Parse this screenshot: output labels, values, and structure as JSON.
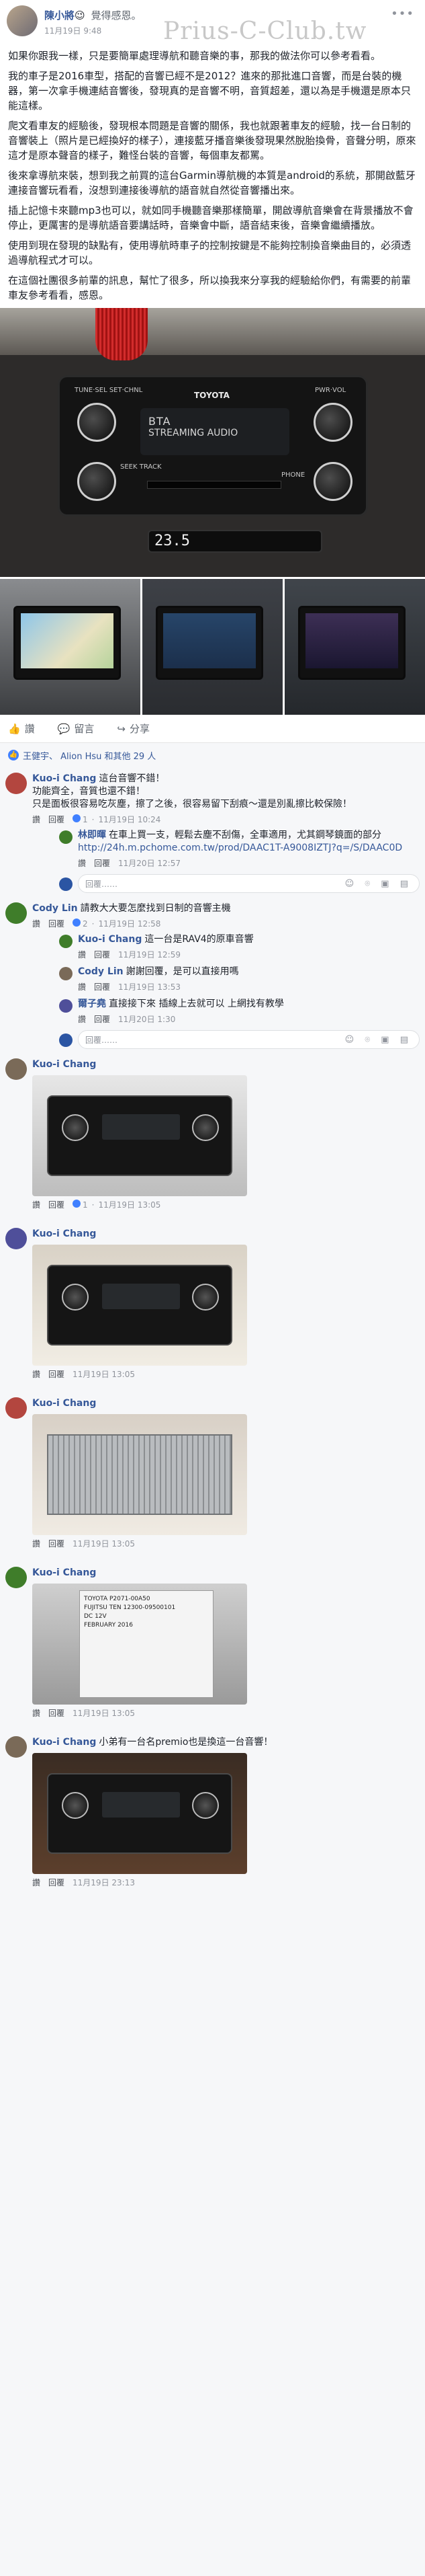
{
  "post": {
    "author": "陳小將",
    "feeling_emoji": "😉",
    "feeling": "覺得感恩。",
    "date": "11月19日 9:48",
    "watermark": "Prius-C-Club.tw",
    "more_icon": "more-dots-icon",
    "paragraphs": [
      "如果你跟我一樣，只是要簡單處理導航和聽音樂的事，那我的做法你可以參考看看。",
      "我的車子是2016車型，搭配的音響已經不是2012？進來的那批進口音響，而是台裝的機器，第一次拿手機連結音響後，發現真的是音響不明，音質超差，還以為是手機還是原本只能這樣。",
      "爬文看車友的經驗後，發現根本問題是音響的關係，我也就跟著車友的經驗，找一台日制的音響裝上（照片是已經換好的樣子），連接藍牙播音樂後發現果然脫胎換骨，音聲分明，原來這才是原本聲音的樣子，難怪台裝的音響，每個車友都罵。",
      "後來拿導航來裝，想到我之前買的這台Garmin導航機的本質是android的系統，那開啟藍牙連接音響玩看看，沒想到連接後導航的語音就自然從音響播出來。",
      "插上記憶卡來聽mp3也可以，就如同手機聽音樂那樣簡單，開啟導航音樂會在背景播放不會停止，更厲害的是導航語音要講話時，音樂會中斷，語音結束後，音樂會繼續播放。",
      "使用到現在發現的缺點有，使用導航時車子的控制按鍵是不能夠控制換音樂曲目的，必須透過導航程式才可以。",
      "在這個社團很多前輩的訊息，幫忙了很多，所以換我來分享我的經驗給你們，有需要的前輩車友參考看看，感恩。"
    ],
    "radio": {
      "brand": "TOYOTA",
      "display_line1": "BTA",
      "display_line2": "STREAMING AUDIO",
      "knob_left_label": "TUNE·SEL\nSET·CHNL",
      "knob_right_label": "PWR·VOL",
      "seek_label": "SEEK\nTRACK",
      "phone_label": "PHONE",
      "climate_temp": "23.5"
    }
  },
  "actions": {
    "like": "讚",
    "comment": "留言",
    "share": "分享"
  },
  "reactions": {
    "text": "王健宇、 Alion Hsu 和其他 29 人"
  },
  "comments": [
    {
      "name": "Kuo-i Chang",
      "text": "這台音響不錯！\n功能齊全，音質也還不錯！\n只是面板很容易吃灰塵，擦了之後，很容易留下刮痕～還是別亂擦比較保險！",
      "like": "讚",
      "reply": "回覆",
      "likes": "1",
      "time": "11月19日 10:24",
      "replies": [
        {
          "name": "林即暉",
          "text": "在車上買一支，輕鬆去塵不刮傷，全車適用，尤其鋼琴鏡面的部分",
          "link": "http://24h.m.pchome.com.tw/prod/DAAC1T-A9008IZTJ?q=/S/DAAC0D",
          "like": "讚",
          "reply": "回覆",
          "time": "11月20日 12:57"
        }
      ],
      "reply_placeholder": "回覆……"
    },
    {
      "name": "Cody Lin",
      "text": "請教大大要怎麼找到日制的音響主機",
      "like": "讚",
      "reply": "回覆",
      "likes": "2",
      "time": "11月19日 12:58",
      "replies": [
        {
          "name": "Kuo-i Chang",
          "text": "這一台是RAV4的原車音響",
          "like": "讚",
          "reply": "回覆",
          "time": "11月19日 12:59"
        },
        {
          "name": "Cody Lin",
          "text": "謝謝回覆，是可以直接用嗎",
          "like": "讚",
          "reply": "回覆",
          "time": "11月19日 13:53"
        },
        {
          "name": "爾子堯",
          "text": "直接接下來 插線上去就可以 上網找有教學",
          "like": "讚",
          "reply": "回覆",
          "time": "11月20日 1:30"
        }
      ],
      "reply_placeholder": "回覆……"
    },
    {
      "name": "Kuo-i Chang",
      "text": "",
      "like": "讚",
      "reply": "回覆",
      "likes": "1",
      "time": "11月19日 13:05",
      "photo": "p1"
    },
    {
      "name": "Kuo-i Chang",
      "text": "",
      "like": "讚",
      "reply": "回覆",
      "time": "11月19日 13:05",
      "photo": "p2"
    },
    {
      "name": "Kuo-i Chang",
      "text": "",
      "like": "讚",
      "reply": "回覆",
      "time": "11月19日 13:05",
      "photo": "p3"
    },
    {
      "name": "Kuo-i Chang",
      "text": "",
      "like": "讚",
      "reply": "回覆",
      "time": "11月19日 13:05",
      "photo": "p4",
      "sticker": "TOYOTA  P2071-00A50\nFUJITSU TEN  12300-09500101\nDC 12V\nFEBRUARY 2016"
    },
    {
      "name": "Kuo-i Chang",
      "text": "小弟有一台名premio也是換這一台音響！",
      "like": "讚",
      "reply": "回覆",
      "time": "11月19日 23:13",
      "photo": "p5"
    }
  ],
  "colors": {
    "link_blue": "#365899",
    "meta_gray": "#90949c",
    "comment_bg": "#f6f7f9"
  }
}
